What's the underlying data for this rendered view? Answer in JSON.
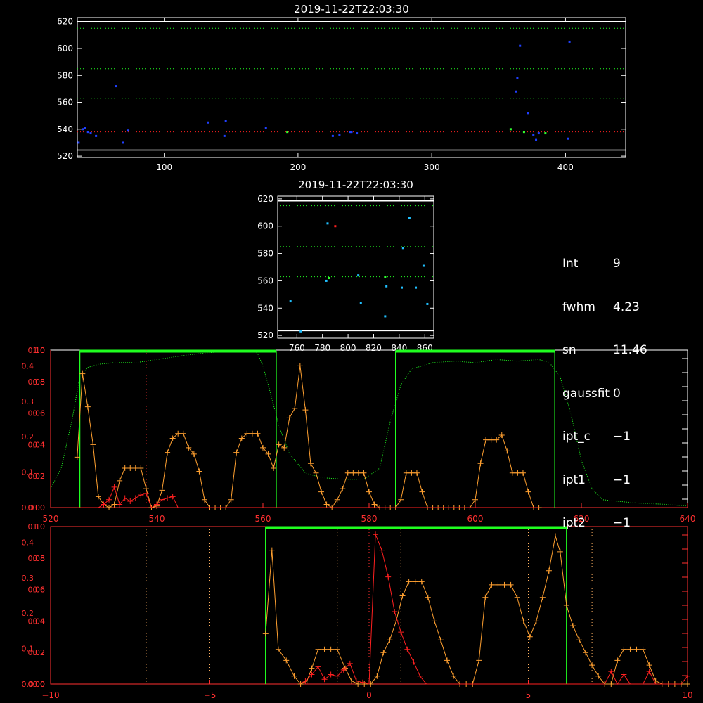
{
  "colors": {
    "background": "#000000",
    "frame": "#ffffff",
    "scatter_blue": "#2040ff",
    "scatter_cyan": "#20c0ff",
    "scatter_green": "#30ff30",
    "red_series": "#ff2020",
    "orange_series": "#ffa030",
    "axis_red": "#ff3030",
    "green_ref": "#20ff20",
    "white_ref": "#ffffff",
    "dotted_orange": "#ffb060",
    "dotted_red": "#ff3030"
  },
  "info_panel": [
    {
      "label": "Int",
      "value": "9"
    },
    {
      "label": "fwhm",
      "value": "4.23"
    },
    {
      "label": "sn",
      "value": "11.46"
    },
    {
      "label": "gaussfit",
      "value": "0"
    },
    {
      "label": "ipt_c",
      "value": "−1"
    },
    {
      "label": "ipt1",
      "value": "−1"
    },
    {
      "label": "ipt2",
      "value": "−1"
    }
  ],
  "chart_data": [
    {
      "type": "scatter",
      "title": "2019-11-22T22:03:30",
      "xlim": [
        35,
        445
      ],
      "ylim": [
        519,
        623
      ],
      "x_ticks": [
        "100",
        "200",
        "300",
        "400"
      ],
      "x_tick_values": [
        100,
        200,
        300,
        400
      ],
      "y_ticks": [
        "520",
        "540",
        "560",
        "580",
        "600",
        "620"
      ],
      "y_tick_values": [
        520,
        540,
        560,
        580,
        600,
        620
      ],
      "hlines": [
        {
          "y": 620,
          "style": "white-solid"
        },
        {
          "y": 524.5,
          "style": "white-solid"
        },
        {
          "y": 615,
          "style": "green-dotted"
        },
        {
          "y": 585,
          "style": "green-dotted"
        },
        {
          "y": 563,
          "style": "green-dotted"
        },
        {
          "y": 538,
          "style": "red-dotted"
        }
      ],
      "points_blue": [
        [
          36,
          530
        ],
        [
          39,
          540
        ],
        [
          41,
          541
        ],
        [
          43,
          538
        ],
        [
          45,
          537
        ],
        [
          49,
          535
        ],
        [
          64,
          572
        ],
        [
          69,
          530
        ],
        [
          73,
          539
        ],
        [
          133,
          545
        ],
        [
          145,
          535
        ],
        [
          146,
          546
        ],
        [
          176,
          541
        ],
        [
          226,
          535
        ],
        [
          231,
          536
        ],
        [
          239,
          538
        ],
        [
          240,
          538
        ],
        [
          244,
          537
        ],
        [
          363,
          568
        ],
        [
          364,
          578
        ],
        [
          366,
          602
        ],
        [
          372,
          552
        ],
        [
          376,
          536
        ],
        [
          378,
          532
        ],
        [
          380,
          537
        ],
        [
          402,
          533
        ],
        [
          403,
          605
        ]
      ],
      "points_green": [
        [
          192,
          538
        ],
        [
          359,
          540
        ],
        [
          369,
          538
        ],
        [
          385,
          537
        ]
      ]
    },
    {
      "type": "scatter",
      "title": "2019-11-22T22:03:30",
      "xlim": [
        745,
        867
      ],
      "ylim": [
        518,
        622
      ],
      "x_ticks": [
        "760",
        "780",
        "800",
        "820",
        "840",
        "860"
      ],
      "x_tick_values": [
        760,
        780,
        800,
        820,
        840,
        860
      ],
      "y_ticks": [
        "520",
        "540",
        "560",
        "580",
        "600",
        "620"
      ],
      "y_tick_values": [
        520,
        540,
        560,
        580,
        600,
        620
      ],
      "hlines": [
        {
          "y": 618.5,
          "style": "white-solid"
        },
        {
          "y": 523.5,
          "style": "white-solid"
        },
        {
          "y": 615,
          "style": "green-dotted"
        },
        {
          "y": 585,
          "style": "green-dotted"
        },
        {
          "y": 563,
          "style": "green-dotted"
        }
      ],
      "points_cyan": [
        [
          755,
          545
        ],
        [
          783,
          560
        ],
        [
          784,
          602
        ],
        [
          808,
          564
        ],
        [
          810,
          544
        ],
        [
          829,
          534
        ],
        [
          830,
          556
        ],
        [
          842,
          555
        ],
        [
          843,
          584
        ],
        [
          848,
          606
        ],
        [
          853,
          555
        ],
        [
          859,
          571
        ],
        [
          862,
          543
        ],
        [
          763,
          523
        ]
      ],
      "points_green": [
        [
          785,
          562
        ],
        [
          829,
          563
        ]
      ],
      "points_red": [
        [
          790,
          600
        ]
      ]
    },
    {
      "type": "line",
      "xlim": [
        520,
        640
      ],
      "x_ticks": [
        "520",
        "540",
        "560",
        "580",
        "600",
        "620",
        "640"
      ],
      "x_tick_values": [
        520,
        540,
        560,
        580,
        600,
        620,
        640
      ],
      "y_ticks_left_a": [
        "0.0",
        "0.2",
        "0.4",
        "0.6",
        "0.8",
        "1.0"
      ],
      "y_ticks_left_b": [
        "0.00",
        "0.02",
        "0.04",
        "0.06",
        "0.08",
        "0.10"
      ],
      "y_ticks_left_c": [
        "0.0",
        "0.1",
        "0.2",
        "0.3",
        "0.4"
      ],
      "green_boxes": [
        [
          525.5,
          562.5
        ],
        [
          585.0,
          615.0
        ]
      ],
      "red_marker_x": 538,
      "filter_curve": {
        "x": [
          520,
          522,
          524,
          525.5,
          527,
          529,
          532,
          536,
          540,
          546,
          552,
          556,
          558,
          559,
          560,
          561,
          562,
          563,
          565,
          568,
          571,
          575,
          579,
          582,
          584,
          586,
          588,
          592,
          596,
          600,
          604,
          608,
          612,
          614,
          616,
          618,
          620,
          622,
          624,
          630,
          636,
          640
        ],
        "y": [
          0.12,
          0.25,
          0.55,
          0.83,
          0.89,
          0.91,
          0.92,
          0.92,
          0.94,
          0.97,
          0.99,
          0.99,
          1.0,
          0.98,
          0.9,
          0.78,
          0.65,
          0.52,
          0.34,
          0.22,
          0.19,
          0.18,
          0.18,
          0.25,
          0.55,
          0.78,
          0.88,
          0.92,
          0.93,
          0.92,
          0.94,
          0.93,
          0.94,
          0.92,
          0.83,
          0.6,
          0.3,
          0.12,
          0.05,
          0.03,
          0.02,
          0.01
        ]
      },
      "series": [
        {
          "color": "orange",
          "x": [
            525,
            526,
            527,
            528,
            529,
            530,
            531,
            532,
            533,
            534,
            535,
            536,
            537,
            538,
            539,
            540,
            541,
            542,
            543,
            544,
            545,
            546,
            547,
            548,
            549,
            550,
            551,
            552,
            553,
            554,
            555,
            556,
            557,
            558,
            559,
            560,
            561,
            562,
            563,
            564,
            565,
            566,
            567,
            568,
            569,
            570,
            571,
            572,
            573,
            574,
            575,
            576,
            577,
            578,
            579,
            580,
            581,
            582,
            583,
            584,
            585,
            586,
            587,
            588,
            589,
            590,
            591,
            592,
            593,
            594,
            595,
            596,
            597,
            598,
            599,
            600,
            601,
            602,
            603,
            604,
            605,
            606,
            607,
            608,
            609,
            610,
            611,
            612
          ],
          "y": [
            0.32,
            0.85,
            0.64,
            0.4,
            0.07,
            0.02,
            0.0,
            0.02,
            0.17,
            0.25,
            0.25,
            0.25,
            0.25,
            0.12,
            0.0,
            0.01,
            0.11,
            0.35,
            0.44,
            0.47,
            0.47,
            0.38,
            0.34,
            0.23,
            0.05,
            0.0,
            0.0,
            0.0,
            0.0,
            0.05,
            0.35,
            0.44,
            0.47,
            0.47,
            0.47,
            0.38,
            0.34,
            0.25,
            0.4,
            0.38,
            0.57,
            0.63,
            0.9,
            0.62,
            0.28,
            0.22,
            0.1,
            0.02,
            0.0,
            0.05,
            0.12,
            0.22,
            0.22,
            0.22,
            0.22,
            0.1,
            0.02,
            0.0,
            0.0,
            0.0,
            0.0,
            0.05,
            0.22,
            0.22,
            0.22,
            0.1,
            0.0,
            0.0,
            0.0,
            0.0,
            0.0,
            0.0,
            0.0,
            0.0,
            0.0,
            0.05,
            0.28,
            0.43,
            0.43,
            0.43,
            0.46,
            0.36,
            0.22,
            0.22,
            0.22,
            0.1,
            0.0,
            0.0
          ]
        },
        {
          "color": "red",
          "x": [
            525,
            526,
            527,
            528,
            529,
            530,
            531,
            532,
            533,
            534,
            535,
            536,
            537,
            538,
            539,
            540,
            541,
            542,
            543,
            544,
            545,
            546,
            547,
            548,
            549,
            550,
            551,
            552,
            553,
            554,
            555,
            556,
            557,
            558,
            559,
            560,
            561,
            562,
            563,
            564,
            565,
            566,
            567,
            568,
            569,
            570,
            571,
            572,
            573,
            574,
            575,
            576,
            577,
            578,
            579,
            580,
            581,
            582,
            583,
            584,
            585,
            586,
            587,
            588,
            589,
            590,
            591,
            592,
            593,
            594,
            595,
            596,
            597,
            598,
            599,
            600,
            601,
            602,
            603,
            604,
            605,
            606,
            607,
            608,
            609,
            610,
            611,
            612
          ],
          "y": [
            0.0,
            0.0,
            0.0,
            0.0,
            0.0,
            0.02,
            0.05,
            0.13,
            0.02,
            0.06,
            0.04,
            0.06,
            0.08,
            0.09,
            0.0,
            0.02,
            0.05,
            0.06,
            0.07,
            0.0,
            0.0,
            0.0,
            0.0,
            0.0,
            0.0,
            0.0,
            0.0,
            0.0,
            0.0,
            0.0,
            0.0,
            0.0,
            0.0,
            0.0,
            0.0,
            0.0,
            0.0,
            0.0,
            0.0,
            0.0,
            0.0,
            0.0,
            0.0,
            0.0,
            0.0,
            0.0,
            0.0,
            0.0,
            0.0,
            0.0,
            0.0,
            0.0,
            0.0,
            0.0,
            0.0,
            0.0,
            0.0,
            0.0,
            0.0,
            0.0,
            0.0,
            0.0,
            0.0,
            0.0,
            0.0,
            0.0,
            0.0,
            0.0,
            0.0,
            0.0,
            0.0,
            0.0,
            0.0,
            0.0,
            0.0,
            0.0,
            0.0,
            0.0,
            0.0,
            0.0,
            0.0,
            0.0,
            0.0,
            0.0,
            0.0,
            0.0,
            0.0,
            0.0
          ]
        }
      ]
    },
    {
      "type": "line",
      "xlim": [
        -10,
        10
      ],
      "x_ticks": [
        "−10",
        "−5",
        "0",
        "5",
        "10"
      ],
      "x_tick_values": [
        -10,
        -5,
        0,
        5,
        10
      ],
      "y_ticks_left_a": [
        "0.0",
        "0.2",
        "0.4",
        "0.6",
        "0.8",
        "1.0"
      ],
      "y_ticks_left_b": [
        "0.00",
        "0.02",
        "0.04",
        "0.06",
        "0.08",
        "0.10"
      ],
      "y_ticks_left_c": [
        "0.0",
        "0.1",
        "0.2",
        "0.3",
        "0.4"
      ],
      "green_box": [
        -3.25,
        6.2
      ],
      "vlines_orange": [
        -7,
        -5,
        -1,
        1,
        5,
        7
      ],
      "vline_red": 0,
      "series": [
        {
          "color": "orange",
          "x": [
            -3.25,
            -3.05,
            -2.85,
            -2.6,
            -2.35,
            -2.15,
            -1.95,
            -1.8,
            -1.6,
            -1.4,
            -1.2,
            -1.0,
            -0.75,
            -0.55,
            -0.35,
            -0.15,
            0.05,
            0.25,
            0.45,
            0.65,
            0.85,
            1.05,
            1.25,
            1.45,
            1.65,
            1.85,
            2.05,
            2.25,
            2.45,
            2.65,
            2.85,
            3.05,
            3.25,
            3.45,
            3.65,
            3.85,
            4.05,
            4.25,
            4.45,
            4.65,
            4.85,
            5.05,
            5.25,
            5.45,
            5.65,
            5.85,
            6.0,
            6.2,
            6.4,
            6.6,
            6.8,
            7.0,
            7.2,
            7.4,
            7.6,
            7.8,
            8.0,
            8.2,
            8.4,
            8.6,
            8.8,
            9.0,
            9.2,
            9.4,
            9.6,
            9.8,
            10.0
          ],
          "y": [
            0.32,
            0.85,
            0.22,
            0.15,
            0.05,
            0.0,
            0.02,
            0.1,
            0.22,
            0.22,
            0.22,
            0.22,
            0.1,
            0.02,
            0.0,
            0.0,
            0.0,
            0.05,
            0.2,
            0.28,
            0.4,
            0.56,
            0.65,
            0.65,
            0.65,
            0.55,
            0.4,
            0.28,
            0.15,
            0.05,
            0.0,
            0.0,
            0.0,
            0.15,
            0.55,
            0.63,
            0.63,
            0.63,
            0.63,
            0.55,
            0.4,
            0.3,
            0.4,
            0.55,
            0.72,
            0.94,
            0.84,
            0.5,
            0.37,
            0.28,
            0.2,
            0.12,
            0.05,
            0.0,
            0.0,
            0.15,
            0.22,
            0.22,
            0.22,
            0.22,
            0.12,
            0.02,
            0.0,
            0.0,
            0.0,
            0.0,
            0.0
          ]
        },
        {
          "color": "red",
          "x": [
            -2.2,
            -2.0,
            -1.8,
            -1.6,
            -1.4,
            -1.2,
            -1.0,
            -0.8,
            -0.6,
            -0.4,
            -0.2,
            0.0,
            0.2,
            0.4,
            0.6,
            0.8,
            1.0,
            1.2,
            1.4,
            1.6,
            1.8,
            2.0,
            2.2,
            2.4,
            2.6,
            2.8,
            3.0,
            3.2,
            3.4,
            3.6,
            3.8,
            4.0,
            4.2,
            4.4,
            4.6,
            4.8,
            5.0,
            5.2,
            5.4,
            5.6,
            5.8,
            6.0,
            6.2,
            6.4,
            6.6,
            6.8,
            7.0,
            7.2,
            7.4,
            7.6,
            7.8,
            8.0,
            8.2,
            8.4,
            8.6,
            8.8,
            9.0,
            9.2,
            9.4,
            9.6,
            9.8,
            10.0
          ],
          "y": [
            0.0,
            0.02,
            0.06,
            0.11,
            0.03,
            0.06,
            0.05,
            0.09,
            0.13,
            0.02,
            0.01,
            0.0,
            0.95,
            0.85,
            0.68,
            0.46,
            0.33,
            0.22,
            0.14,
            0.05,
            0.0,
            0.0,
            0.0,
            0.0,
            0.0,
            0.0,
            0.0,
            0.0,
            0.0,
            0.0,
            0.0,
            0.0,
            0.0,
            0.0,
            0.0,
            0.0,
            0.0,
            0.0,
            0.0,
            0.0,
            0.0,
            0.0,
            0.0,
            0.0,
            0.0,
            0.0,
            0.0,
            0.0,
            0.0,
            0.08,
            0.0,
            0.06,
            0.0,
            0.0,
            0.0,
            0.08,
            0.0,
            0.0,
            0.0,
            0.0,
            0.0,
            0.05
          ]
        }
      ]
    }
  ]
}
